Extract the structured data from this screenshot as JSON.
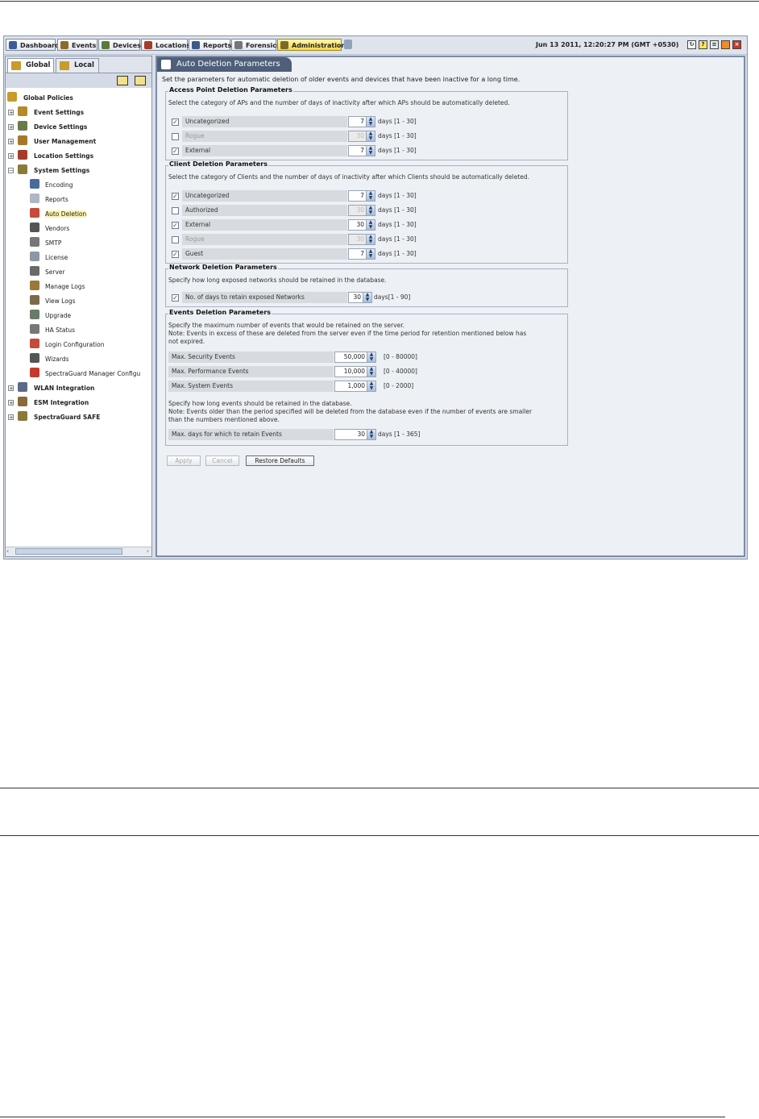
{
  "nav": {
    "tabs": [
      {
        "label": "Dashboard",
        "icon": "dashboard-icon"
      },
      {
        "label": "Events",
        "icon": "events-icon"
      },
      {
        "label": "Devices",
        "icon": "devices-icon"
      },
      {
        "label": "Locations",
        "icon": "locations-icon"
      },
      {
        "label": "Reports",
        "icon": "reports-icon"
      },
      {
        "label": "Forensics",
        "icon": "forensics-icon"
      },
      {
        "label": "Administration",
        "icon": "administration-icon",
        "active": true
      }
    ],
    "datetime": "Jun 13 2011, 12:20:27 PM (GMT +0530)"
  },
  "left": {
    "tabs": {
      "global": "Global",
      "local": "Local"
    },
    "tree": [
      {
        "label": "Global Policies"
      },
      {
        "label": "Event Settings"
      },
      {
        "label": "Device Settings"
      },
      {
        "label": "User Management"
      },
      {
        "label": "Location Settings"
      },
      {
        "label": "System Settings"
      },
      {
        "label": "Encoding"
      },
      {
        "label": "Reports"
      },
      {
        "label": "Auto Deletion"
      },
      {
        "label": "Vendors"
      },
      {
        "label": "SMTP"
      },
      {
        "label": "License"
      },
      {
        "label": "Server"
      },
      {
        "label": "Manage Logs"
      },
      {
        "label": "View Logs"
      },
      {
        "label": "Upgrade"
      },
      {
        "label": "HA Status"
      },
      {
        "label": "Login Configuration"
      },
      {
        "label": "Wizards"
      },
      {
        "label": "SpectraGuard Manager Configu"
      },
      {
        "label": "WLAN Integration"
      },
      {
        "label": "ESM Integration"
      },
      {
        "label": "SpectraGuard SAFE"
      }
    ]
  },
  "content": {
    "title": "Auto Deletion Parameters",
    "intro": "Set the parameters for automatic deletion of older events and devices that have been inactive for a long time.",
    "ap": {
      "title": "Access Point Deletion Parameters",
      "desc": "Select the category of APs and the number of days of inactivity after which APs should be automatically deleted.",
      "rows": [
        {
          "label": "Uncategorized",
          "value": "7",
          "unit": "days [1 - 30]",
          "checked": true
        },
        {
          "label": "Rogue",
          "value": "30",
          "unit": "days [1 - 30]",
          "checked": false
        },
        {
          "label": "External",
          "value": "7",
          "unit": "days [1 - 30]",
          "checked": true
        }
      ]
    },
    "client": {
      "title": "Client Deletion Parameters",
      "desc": "Select the category of Clients and the number of days of inactivity after which Clients should be automatically deleted.",
      "rows": [
        {
          "label": "Uncategorized",
          "value": "7",
          "unit": "days [1 - 30]",
          "checked": true
        },
        {
          "label": "Authorized",
          "value": "30",
          "unit": "days [1 - 30]",
          "checked": false
        },
        {
          "label": "External",
          "value": "30",
          "unit": "days [1 - 30]",
          "checked": true
        },
        {
          "label": "Rogue",
          "value": "30",
          "unit": "days [1 - 30]",
          "checked": false
        },
        {
          "label": "Guest",
          "value": "7",
          "unit": "days [1 - 30]",
          "checked": true
        }
      ]
    },
    "network": {
      "title": "Network Deletion Parameters",
      "desc": "Specify how long exposed networks should be retained in the database.",
      "row": {
        "label": "No. of days to retain exposed Networks",
        "value": "30",
        "unit": "days[1 - 90]",
        "checked": true
      }
    },
    "events": {
      "title": "Events Deletion Parameters",
      "desc1": "Specify the maximum number of events that would be retained on the server.",
      "desc2": "Note: Events in excess of these are deleted from the server even if the time period for retention mentioned below has",
      "desc3": "not expired.",
      "rows": [
        {
          "label": "Max. Security Events",
          "value": "50,000",
          "unit": "[0 - 80000]"
        },
        {
          "label": "Max. Performance Events",
          "value": "10,000",
          "unit": "[0 - 40000]"
        },
        {
          "label": "Max. System Events",
          "value": "1,000",
          "unit": "[0 - 2000]"
        }
      ],
      "desc4": "Specify how long events should be retained in the database.",
      "desc5": "Note: Events older than the period specified will be deleted from the database even if the number of events are smaller",
      "desc6": "than the numbers mentioned above.",
      "retain": {
        "label": "Max. days for which to retain Events",
        "value": "30",
        "unit": "days [1 - 365]"
      }
    },
    "buttons": {
      "apply": "Apply",
      "cancel": "Cancel",
      "restore": "Restore Defaults"
    }
  }
}
